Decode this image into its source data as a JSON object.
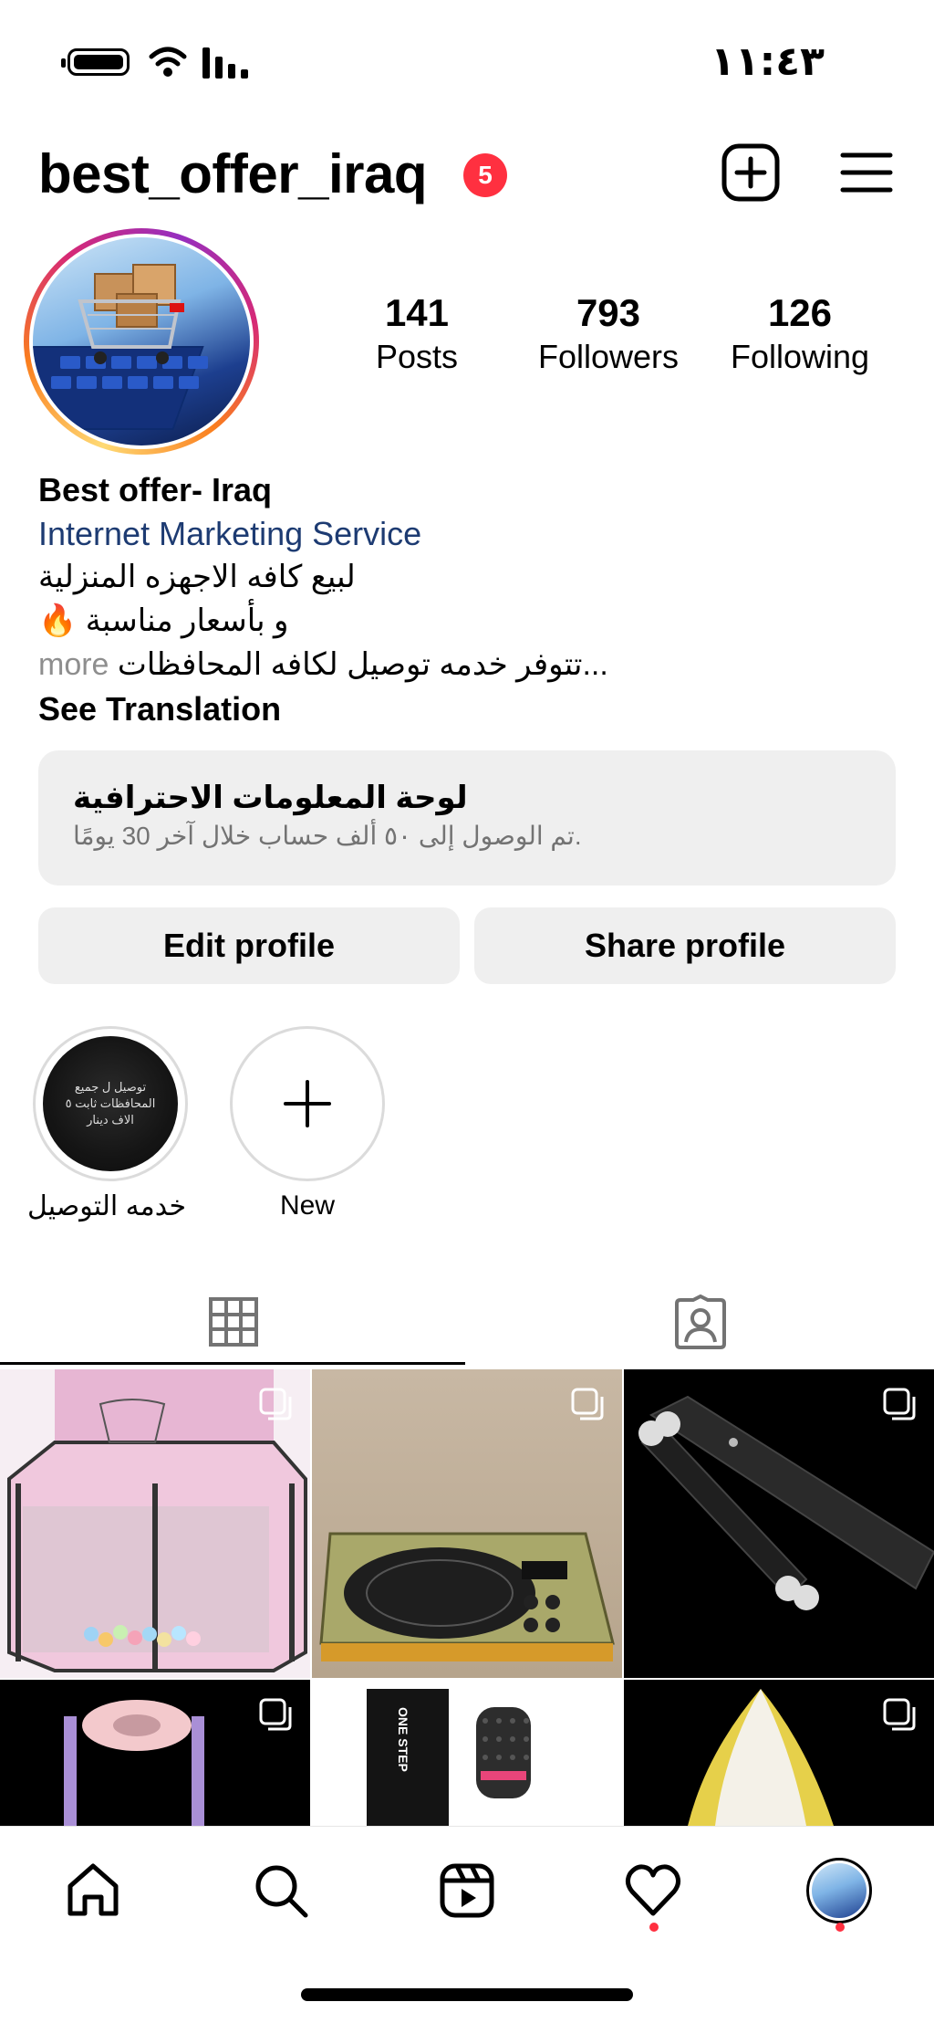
{
  "status_bar": {
    "time": "١١:٤٣"
  },
  "header": {
    "username": "best_offer_iraq",
    "notification_count": "5"
  },
  "stats": [
    {
      "value": "141",
      "label": "Posts"
    },
    {
      "value": "793",
      "label": "Followers"
    },
    {
      "value": "126",
      "label": "Following"
    }
  ],
  "bio": {
    "name": "Best offer- Iraq",
    "category": "Internet Marketing Service",
    "lines": [
      "لبيع كافه الاجهزه المنزلية",
      "و بأسعار مناسبة 🔥",
      "تتوفر خدمه توصيل لكافه المحافظات..."
    ],
    "more": "more",
    "see_translation": "See Translation"
  },
  "dashboard": {
    "title": "لوحة المعلومات الاحترافية",
    "subtitle": "تم الوصول إلى ٥٠ ألف حساب خلال آخر 30 يومًا."
  },
  "buttons": {
    "edit_profile": "Edit profile",
    "share_profile": "Share profile"
  },
  "highlights": [
    {
      "label": "خدمه التوصيل",
      "image_text": "توصيل ل جميع المحافظات ثابت ٥ الاف دينار"
    },
    {
      "label": "New"
    }
  ],
  "tabs": [
    {
      "icon": "grid-icon",
      "active": true
    },
    {
      "icon": "tagged-icon",
      "active": false
    }
  ],
  "grid_posts": [
    {
      "subject": "pink baby playpen",
      "multi": true
    },
    {
      "subject": "induction cooktop",
      "multi": true
    },
    {
      "subject": "black folding stand",
      "multi": true
    },
    {
      "subject": "toilet seat trainer",
      "multi": true
    },
    {
      "subject": "hair dryer brush",
      "multi": true,
      "label": "ONE STEP"
    },
    {
      "subject": "yellow steam iron",
      "multi": true
    }
  ],
  "bottom_nav": [
    "home-icon",
    "search-icon",
    "reels-icon",
    "heart-icon",
    "profile-avatar"
  ],
  "colors": {
    "badge": "#ff3040",
    "category_link": "#1d3b72",
    "card_bg": "#efefef"
  }
}
